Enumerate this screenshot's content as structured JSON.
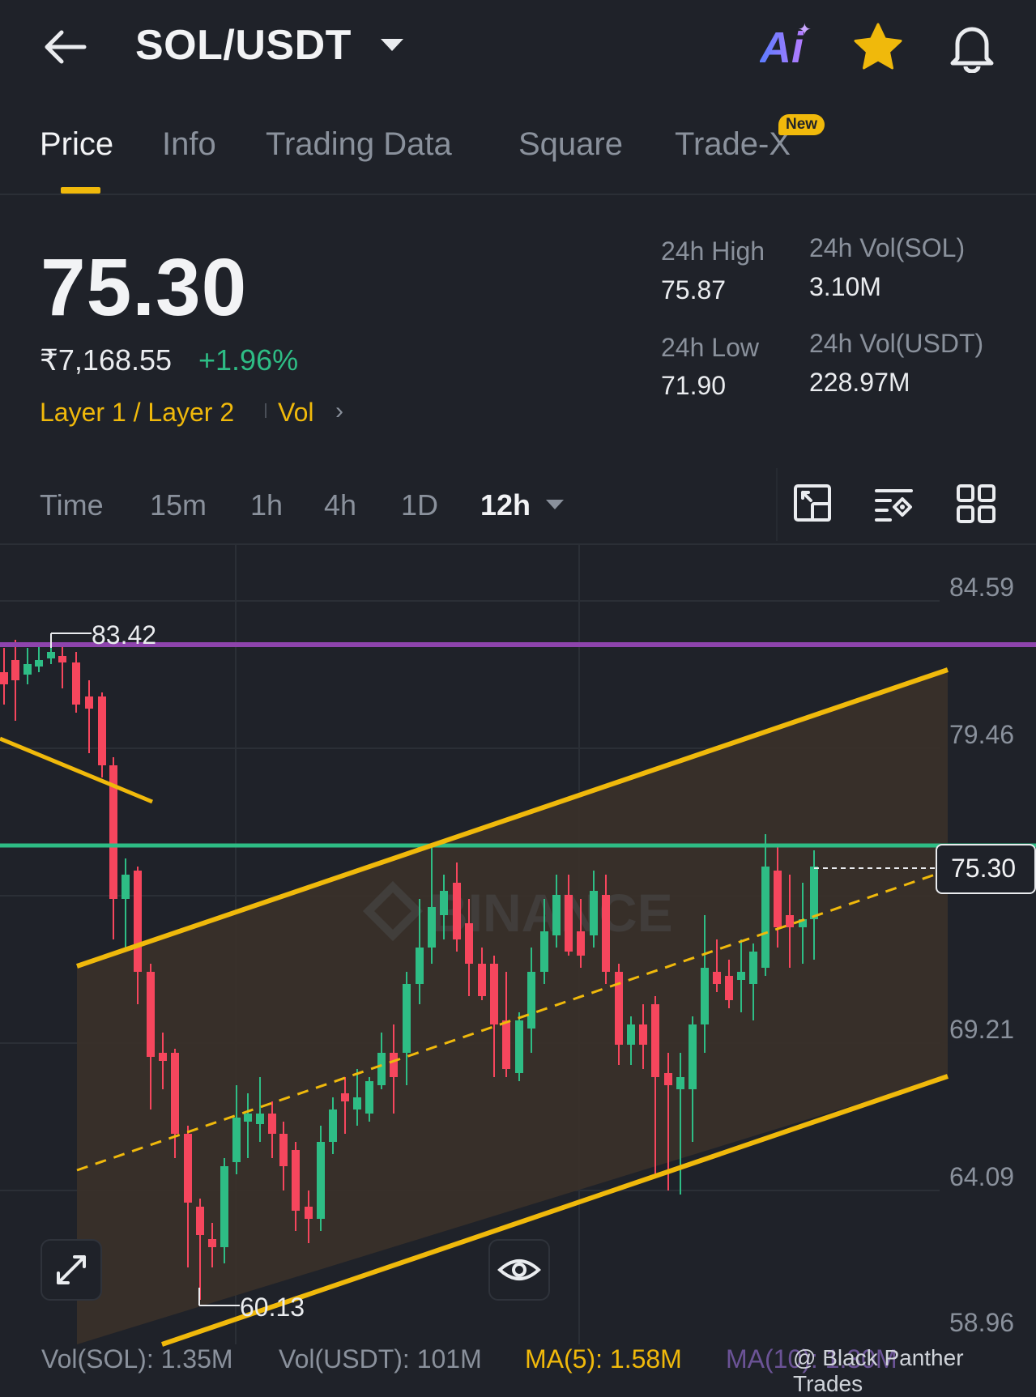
{
  "header": {
    "pair": "SOL/USDT",
    "ai_label": "Ai",
    "icons": [
      "arrow-left-icon",
      "caret-down-icon",
      "ai-icon",
      "star-icon",
      "bell-icon"
    ]
  },
  "tabs": [
    {
      "label": "Price",
      "active": true
    },
    {
      "label": "Info"
    },
    {
      "label": "Trading Data"
    },
    {
      "label": "Square"
    },
    {
      "label": "Trade-X",
      "badge": "New"
    }
  ],
  "ticker": {
    "last_price": "75.30",
    "inr_price": "₹7,168.55",
    "change_pct": "+1.96%",
    "tag_category": "Layer 1 / Layer 2",
    "tag_vol": "Vol",
    "stats": {
      "high_label": "24h High",
      "high_value": "75.87",
      "low_label": "24h Low",
      "low_value": "71.90",
      "vol_sol_label": "24h Vol(SOL)",
      "vol_sol_value": "3.10M",
      "vol_usdt_label": "24h Vol(USDT)",
      "vol_usdt_value": "228.97M"
    }
  },
  "intervals": {
    "items": [
      "Time",
      "15m",
      "1h",
      "4h",
      "1D"
    ],
    "selected": "12h"
  },
  "chart": {
    "axis_labels": [
      "84.59",
      "79.46",
      "75.30",
      "69.21",
      "64.09",
      "58.96"
    ],
    "high_marker": "83.42",
    "low_marker": "60.13",
    "current_price_tag": "75.30",
    "watermark": "BINANCE",
    "colors": {
      "up": "#2ebd85",
      "down": "#f6465d",
      "channel": "#f0b90b",
      "resistance": "#8e44ad",
      "current": "#2ebd85"
    }
  },
  "volume_bar": {
    "vol_sol": "Vol(SOL): 1.35M",
    "vol_usdt": "Vol(USDT): 101M",
    "ma5": "MA(5): 1.58M",
    "ma10": "MA(10): 1.30M",
    "credit": "@ Black Panther Trades"
  }
}
